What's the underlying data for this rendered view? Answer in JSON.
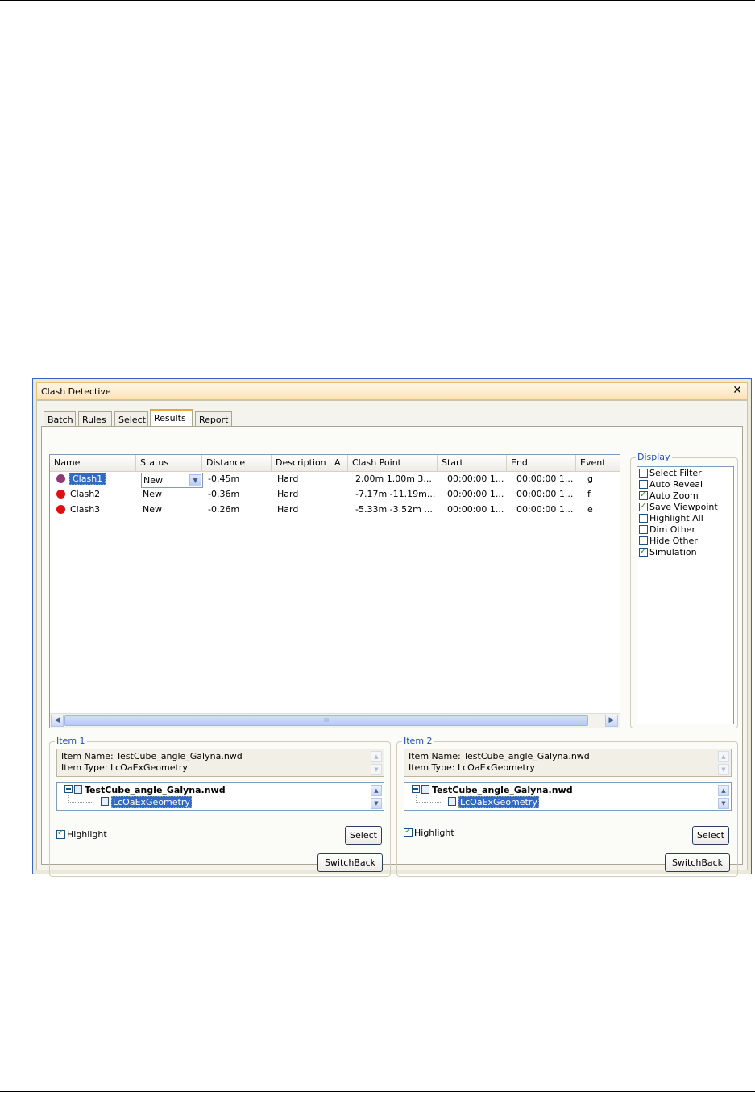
{
  "window": {
    "title": "Clash Detective"
  },
  "tabs": [
    "Batch",
    "Rules",
    "Select",
    "Results",
    "Report"
  ],
  "active_tab": "Results",
  "results": {
    "columns": [
      "Name",
      "Status",
      "Distance",
      "Description",
      "A",
      "Clash Point",
      "Start",
      "End",
      "Event"
    ],
    "rows": [
      {
        "name": "Clash1",
        "status": "New",
        "distance": "-0.45m",
        "description": "Hard",
        "clash_point": "2.00m  1.00m  3...",
        "start": "00:00:00 1...",
        "end": "00:00:00 1...",
        "event": "g",
        "color": "#8e3b74"
      },
      {
        "name": "Clash2",
        "status": "New",
        "distance": "-0.36m",
        "description": "Hard",
        "clash_point": "-7.17m  -11.19m...",
        "start": "00:00:00 1...",
        "end": "00:00:00 1...",
        "event": "f",
        "color": "#e01010"
      },
      {
        "name": "Clash3",
        "status": "New",
        "distance": "-0.26m",
        "description": "Hard",
        "clash_point": "-5.33m  -3.52m  ...",
        "start": "00:00:00 1...",
        "end": "00:00:00 1...",
        "event": "e",
        "color": "#e01010"
      }
    ],
    "scroll_grip": "III"
  },
  "display": {
    "legend": "Display",
    "options": [
      {
        "label": "Select Filter",
        "checked": false
      },
      {
        "label": "Auto Reveal",
        "checked": false
      },
      {
        "label": "Auto Zoom",
        "checked": true
      },
      {
        "label": "Save Viewpoint",
        "checked": true
      },
      {
        "label": "Highlight All",
        "checked": false
      },
      {
        "label": "Dim Other",
        "checked": false
      },
      {
        "label": "Hide Other",
        "checked": false
      },
      {
        "label": "Simulation",
        "checked": true
      }
    ]
  },
  "items": [
    {
      "legend": "Item 1",
      "item_name": "Item Name: TestCube_angle_Galyna.nwd",
      "item_type": "Item Type: LcOaExGeometry",
      "tree_root": "TestCube_angle_Galyna.nwd",
      "tree_child": "LcOaExGeometry",
      "highlight_label": "Highlight",
      "highlight_checked": true,
      "select_label": "Select",
      "switchback_label": "SwitchBack"
    },
    {
      "legend": "Item 2",
      "item_name": "Item Name: TestCube_angle_Galyna.nwd",
      "item_type": "Item Type: LcOaExGeometry",
      "tree_root": "TestCube_angle_Galyna.nwd",
      "tree_child": "LcOaExGeometry",
      "highlight_label": "Highlight",
      "highlight_checked": true,
      "select_label": "Select",
      "switchback_label": "SwitchBack"
    }
  ]
}
